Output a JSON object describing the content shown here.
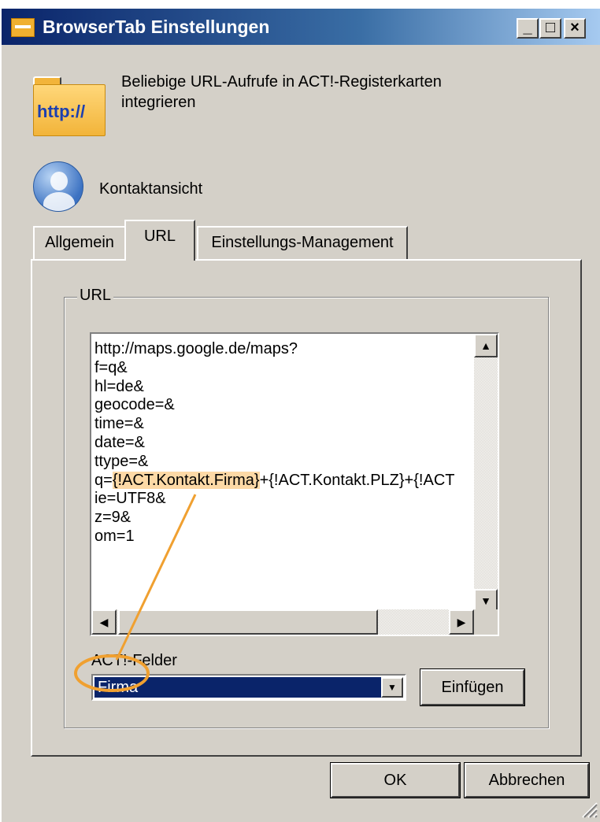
{
  "window": {
    "title": "BrowserTab Einstellungen",
    "buttons": {
      "minimize": "_",
      "maximize": "□",
      "close": "×"
    }
  },
  "header": {
    "icon": "http-folder-icon",
    "icon_label": "http://",
    "description": "Beliebige URL-Aufrufe in ACT!-Registerkarten integrieren"
  },
  "context": {
    "icon": "user-avatar-icon",
    "label": "Kontaktansicht"
  },
  "tabs": [
    {
      "label": "Allgemein",
      "active": false
    },
    {
      "label": "URL",
      "active": true
    },
    {
      "label": "Einstellungs-Management",
      "active": false
    }
  ],
  "url_group": {
    "label": "URL",
    "lines_before": "http://maps.google.de/maps?\nf=q&\nhl=de&\ngeocode=&\ntime=&\ndate=&\nttype=&\nq=",
    "highlight": "{!ACT.Kontakt.Firma}",
    "line_q_rest": "+{!ACT.Kontakt.PLZ}+{!ACT",
    "lines_after": "\nie=UTF8&\nz=9&\nom=1"
  },
  "act_fields": {
    "label": "ACT!-Felder",
    "selected": "Firma",
    "insert_button": "Einfügen"
  },
  "footer": {
    "ok": "OK",
    "cancel": "Abbrechen"
  },
  "colors": {
    "highlight": "#fdd9a6",
    "annotation": "#f0a030",
    "selection": "#0a246a"
  }
}
